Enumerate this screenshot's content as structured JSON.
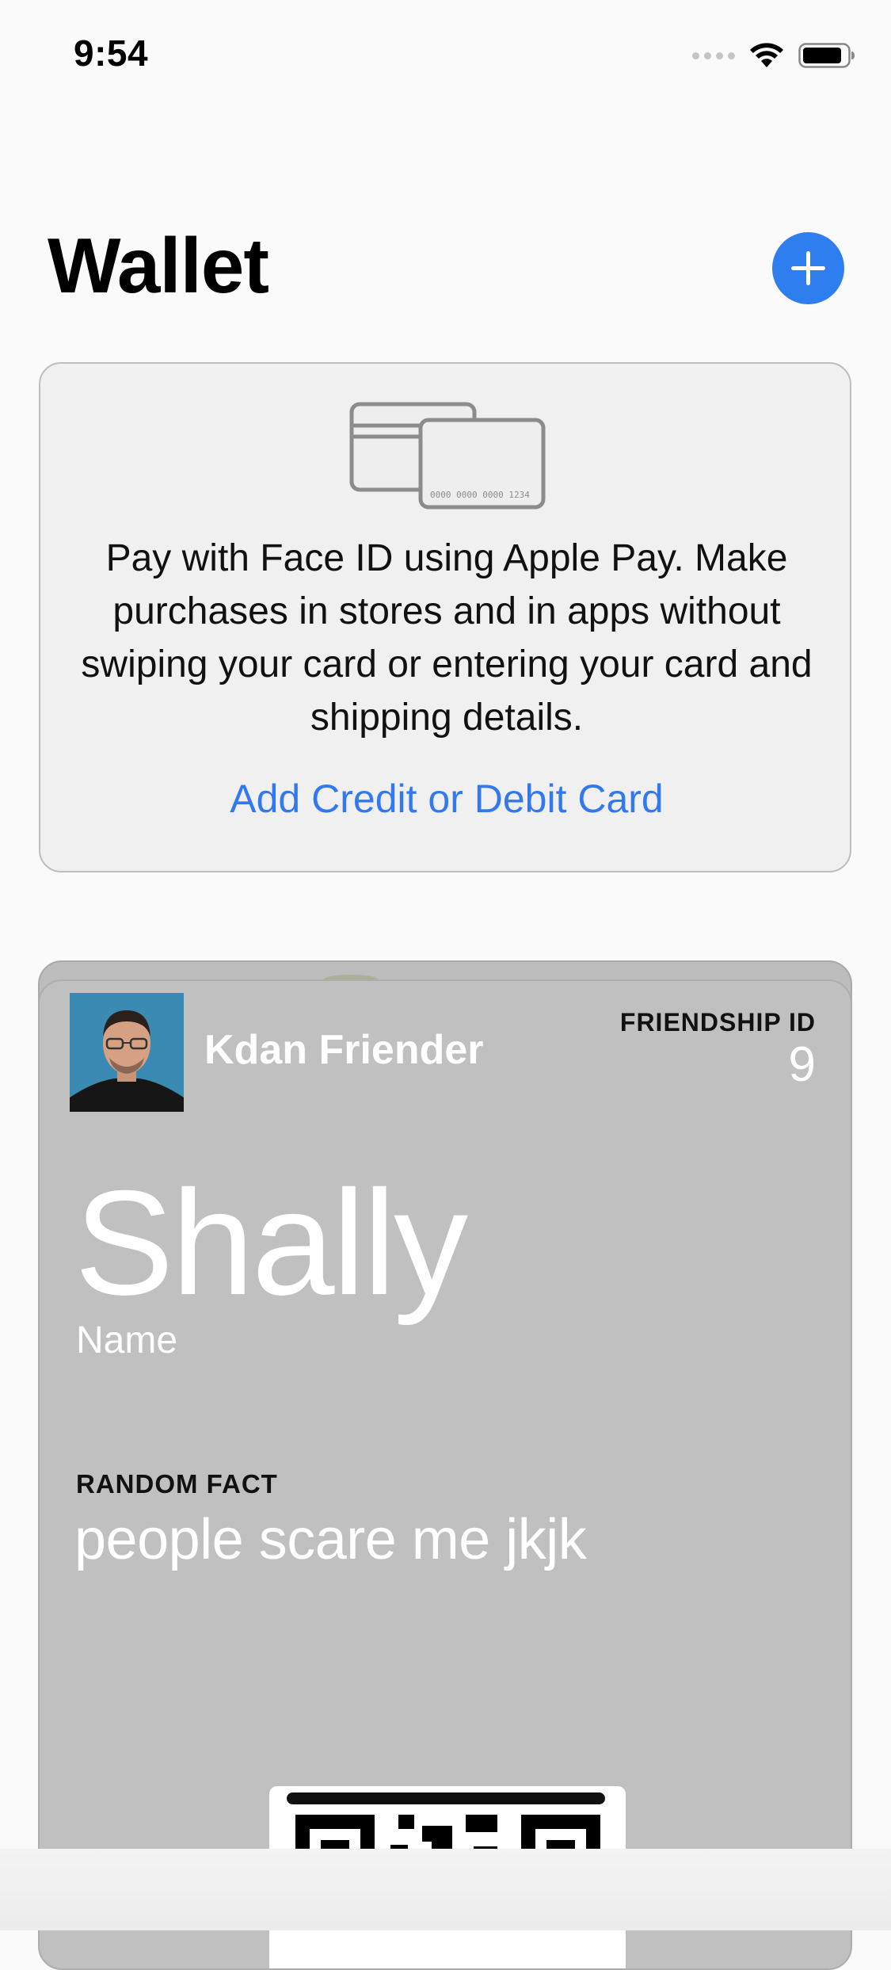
{
  "status_bar": {
    "time": "9:54",
    "icons": [
      "signal-dots-icon",
      "wifi-icon",
      "battery-icon"
    ]
  },
  "header": {
    "title": "Wallet",
    "add_button_icon": "plus-icon"
  },
  "apple_pay_card": {
    "illustration_number": "0000 0000 0000 1234",
    "description": "Pay with Face ID using Apple Pay. Make purchases in stores and in apps without swiping your card or entering your card and shipping details.",
    "link_label": "Add Credit or Debit Card"
  },
  "pass": {
    "organization": "Kdan Friender",
    "header_field": {
      "label": "FRIENDSHIP ID",
      "value": "9"
    },
    "primary_field": {
      "value": "Shally",
      "label": "Name"
    },
    "secondary_field": {
      "label": "RANDOM FACT",
      "value": "people scare me jkjk"
    }
  },
  "colors": {
    "accent": "#2f7ef0",
    "link": "#3478f0",
    "pass_background": "#c0c0c0",
    "page_background": "#fafafa"
  }
}
